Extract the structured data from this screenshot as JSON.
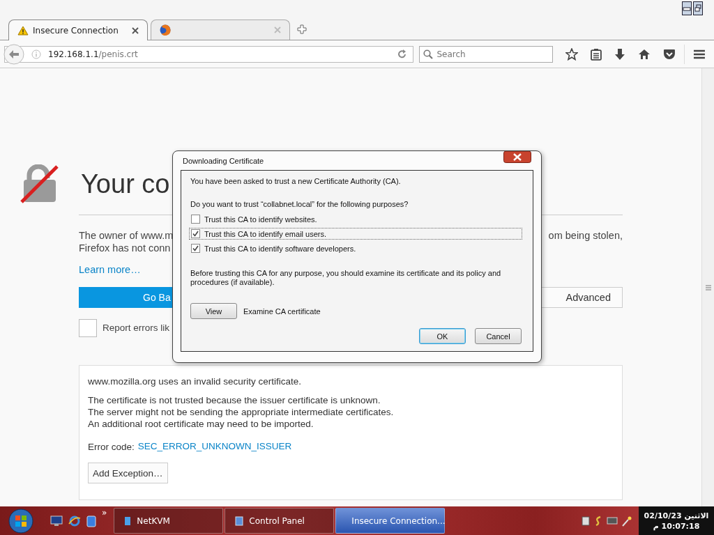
{
  "tabs": [
    {
      "kind": "warning",
      "title": "Insecure Connection",
      "selected": true
    },
    {
      "kind": "browser",
      "selected": false
    }
  ],
  "address": {
    "host": "192.168.1.1",
    "path": "/penis.crt"
  },
  "search": {
    "placeholder": "Search"
  },
  "page": {
    "heading": "Your co",
    "lines_left": [
      "The owner of www.m",
      "Firefox has not conn"
    ],
    "line_right": "om being stolen,",
    "learn_more": "Learn more…",
    "go_back": "Go Ba",
    "advanced": "Advanced",
    "report": {
      "label": "Report errors lik",
      "checked": false
    },
    "details": {
      "first": "www.mozilla.org uses an invalid security certificate.",
      "lines": [
        "The certificate is not trusted because the issuer certificate is unknown.",
        "The server might not be sending the appropriate intermediate certificates.",
        "An additional root certificate may need to be imported."
      ],
      "error_label": "Error code:",
      "error_code": "SEC_ERROR_UNKNOWN_ISSUER",
      "add_exception": "Add Exception…"
    }
  },
  "dialog": {
    "title": "Downloading Certificate",
    "intro": "You have been asked to trust a new Certificate Authority (CA).",
    "question": "Do you want to trust “collabnet.local” for the following purposes?",
    "options": [
      {
        "label": "Trust this CA to identify websites.",
        "checked": false,
        "focused": false
      },
      {
        "label": "Trust this CA to identify email users.",
        "checked": true,
        "focused": true
      },
      {
        "label": "Trust this CA to identify software developers.",
        "checked": true,
        "focused": false
      }
    ],
    "note": "Before trusting this CA for any purpose, you should examine its certificate and its policy and procedures (if available).",
    "view": "View",
    "view_label": "Examine CA certificate",
    "ok": "OK",
    "cancel": "Cancel"
  },
  "taskbar": {
    "overflow": "»",
    "items": [
      {
        "kind": "app",
        "label": "NetKVM",
        "selected": false
      },
      {
        "kind": "panel",
        "label": "Control Panel",
        "selected": false
      },
      {
        "kind": "browser",
        "label": "Insecure Connection...",
        "selected": true
      }
    ],
    "date": "الاثنين 02/10/23",
    "time": "10:07:18 م"
  }
}
